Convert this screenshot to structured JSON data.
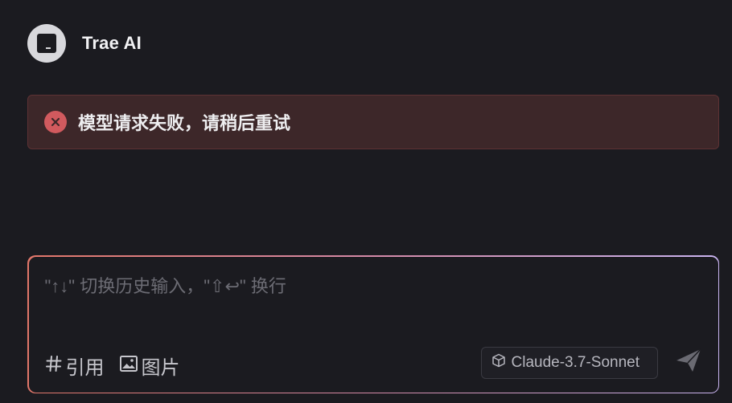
{
  "header": {
    "title": "Trae AI",
    "avatar_icon": "terminal-logo-icon"
  },
  "error": {
    "message": "模型请求失败，请稍后重试",
    "icon": "error-x-circle-icon",
    "color": "#d15a5e"
  },
  "composer": {
    "placeholder": "\"↑↓\" 切换历史输入，\"⇧↩\" 换行",
    "value": "",
    "tools": [
      {
        "icon": "hash-icon",
        "label": "引用"
      },
      {
        "icon": "image-icon",
        "label": "图片"
      }
    ],
    "model": {
      "icon": "cube-icon",
      "label": "Claude-3.7-Sonnet"
    },
    "send_icon": "send-icon"
  },
  "colors": {
    "background": "#1b1b20",
    "error_bg": "#3d2729",
    "gradient": [
      "#e2776a",
      "#d48aa8",
      "#c9b4f0"
    ]
  }
}
